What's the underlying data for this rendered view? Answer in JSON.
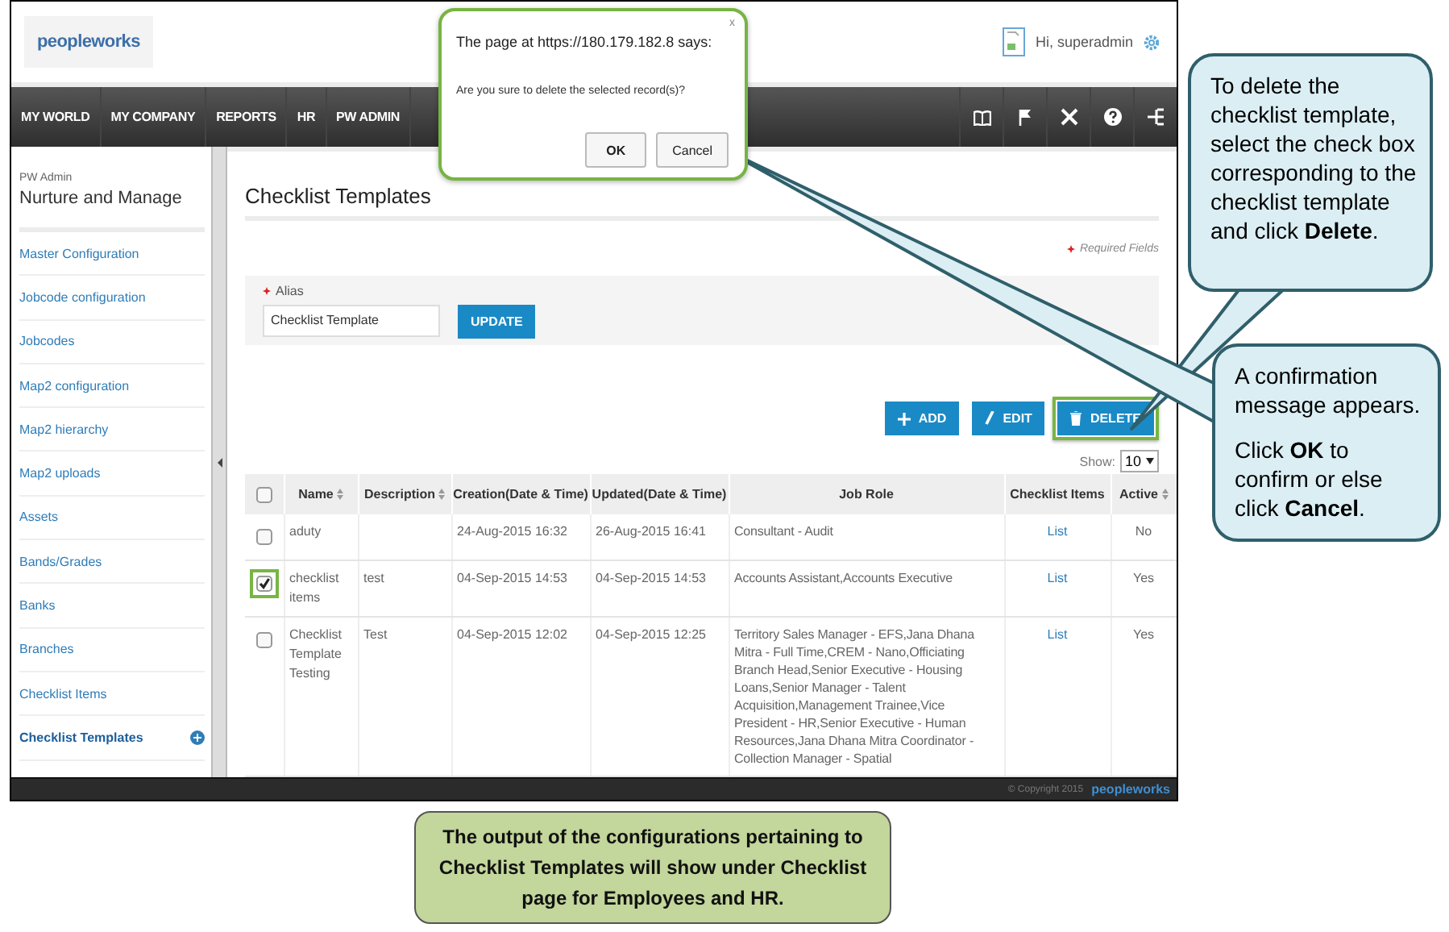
{
  "header": {
    "logo": "peopleworks",
    "greeting": "Hi, superadmin"
  },
  "nav": {
    "items": [
      "MY WORLD",
      "MY COMPANY",
      "REPORTS",
      "HR",
      "PW ADMIN"
    ]
  },
  "sidebar": {
    "section": "PW Admin",
    "title": "Nurture and Manage",
    "items": [
      {
        "label": "Master Configuration",
        "selected": false
      },
      {
        "label": "Jobcode configuration",
        "selected": false
      },
      {
        "label": "Jobcodes",
        "selected": false
      },
      {
        "label": "Map2 configuration",
        "selected": false
      },
      {
        "label": "Map2 hierarchy",
        "selected": false
      },
      {
        "label": "Map2 uploads",
        "selected": false
      },
      {
        "label": "Assets",
        "selected": false
      },
      {
        "label": "Bands/Grades",
        "selected": false
      },
      {
        "label": "Banks",
        "selected": false
      },
      {
        "label": "Branches",
        "selected": false
      },
      {
        "label": "Checklist Items",
        "selected": false
      },
      {
        "label": "Checklist Templates",
        "selected": true
      }
    ]
  },
  "page": {
    "title": "Checklist Templates",
    "required_note": "Required Fields",
    "form": {
      "label": "Alias",
      "value": "Checklist Template",
      "button": "UPDATE"
    },
    "toolbar": [
      {
        "kind": "add",
        "label": "ADD",
        "highlighted": false
      },
      {
        "kind": "edit",
        "label": "EDIT",
        "highlighted": false
      },
      {
        "kind": "delete",
        "label": "DELETE",
        "highlighted": true
      }
    ],
    "show_label": "Show:",
    "show_value": "10"
  },
  "table": {
    "columns": [
      {
        "kind": "checkbox",
        "checked": false
      },
      {
        "kind": "text",
        "label": "Name",
        "sortable": true
      },
      {
        "kind": "text",
        "label": "Description",
        "sortable": true
      },
      {
        "kind": "text",
        "label": "Creation(Date & Time)",
        "sortable": false
      },
      {
        "kind": "text",
        "label": "Updated(Date & Time)",
        "sortable": false
      },
      {
        "kind": "text",
        "label": "Job Role",
        "sortable": false
      },
      {
        "kind": "text",
        "label": "Checklist Items",
        "sortable": false
      },
      {
        "kind": "text",
        "label": "Active",
        "sortable": true
      }
    ],
    "rows": [
      {
        "checked": false,
        "highlighted": false,
        "name": "aduty",
        "created": "24-Aug-2015 16:32",
        "updated": "26-Aug-2015 16:41",
        "job_role": "Consultant - Audit",
        "checklist_items": "List",
        "active": "No"
      },
      {
        "checked": true,
        "highlighted": true,
        "name": "checklist items",
        "description": "test",
        "created": "04-Sep-2015 14:53",
        "updated": "04-Sep-2015 14:53",
        "job_role": "Accounts Assistant,Accounts Executive",
        "checklist_items": "List",
        "active": "Yes"
      },
      {
        "checked": false,
        "highlighted": false,
        "name": "Checklist Template Testing",
        "description": "Test",
        "created": "04-Sep-2015 12:02",
        "updated": "04-Sep-2015 12:25",
        "job_role": "Territory Sales Manager - EFS,Jana Dhana Mitra - Full Time,CREM - Nano,Officiating Branch Head,Senior Executive - Housing Loans,Senior Manager - Talent Acquisition,Management Trainee,Vice President - HR,Senior Executive - Human Resources,Jana Dhana Mitra Coordinator - Collection Manager - Spatial",
        "checklist_items": "List",
        "active": "Yes"
      }
    ]
  },
  "footer": {
    "copyright": "© Copyright 2015",
    "logo": "peopleworks"
  },
  "dialog": {
    "title": "The page at https://180.179.182.8 says:",
    "close": "x",
    "message": "Are you sure to delete the selected record(s)?",
    "buttons": [
      "OK",
      "Cancel"
    ]
  },
  "callouts": [
    {
      "paragraphs": [
        "To delete the checklist template, select the check box corresponding to the checklist template and click **Delete**."
      ]
    },
    {
      "paragraphs": [
        "A confirmation message appears.",
        "Click **OK** to confirm or else click **Cancel**."
      ]
    }
  ],
  "note": "The output of the configurations pertaining to Checklist Templates will show under Checklist page for Employees and HR."
}
